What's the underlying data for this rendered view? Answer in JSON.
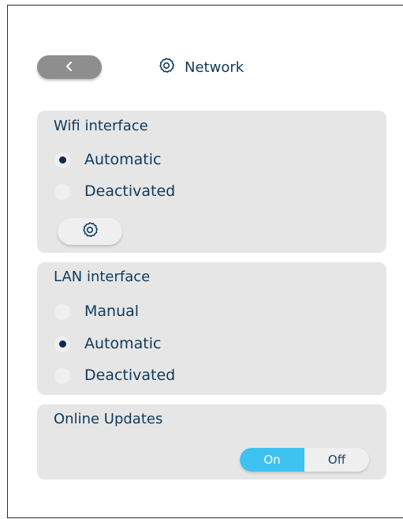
{
  "header": {
    "title": "Network",
    "back_icon": "chevron-left-icon",
    "title_icon": "gear-icon"
  },
  "wifi": {
    "title": "Wifi interface",
    "options": [
      {
        "label": "Automatic",
        "selected": true
      },
      {
        "label": "Deactivated",
        "selected": false
      }
    ],
    "settings_icon": "gear-icon"
  },
  "lan": {
    "title": "LAN interface",
    "options": [
      {
        "label": "Manual",
        "selected": false
      },
      {
        "label": "Automatic",
        "selected": true
      },
      {
        "label": "Deactivated",
        "selected": false
      }
    ]
  },
  "updates": {
    "title": "Online Updates",
    "on_label": "On",
    "off_label": "Off",
    "state": "On"
  },
  "colors": {
    "accent": "#3ec2f0",
    "text": "#0e3a5c",
    "card": "#e6e6e6",
    "back_button": "#8e8e8e"
  }
}
